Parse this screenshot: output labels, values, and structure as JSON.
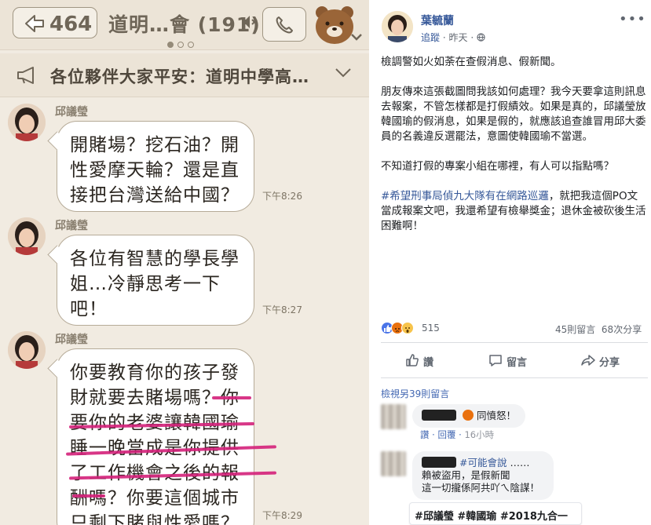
{
  "chat": {
    "back_count": "464",
    "title": "道明…會 (191)",
    "announcement": "各位夥伴大家平安：道明中學高…",
    "messages": [
      {
        "sender": "邱議瑩",
        "lines": [
          "開賭場？挖石油？開",
          "性愛摩天輪？還是直",
          "接把台灣送給中國？"
        ],
        "time": "下午8:26"
      },
      {
        "sender": "邱議瑩",
        "lines": [
          "各位有智慧的學長學",
          "姐…冷靜思考一下",
          "吧！"
        ],
        "time": "下午8:27"
      },
      {
        "sender": "邱議瑩",
        "lines": [
          "你要教育你的孩子發",
          "財就要去賭場嗎？你",
          "要你的老婆讓韓國瑜",
          "睡一晚當成是你提供",
          "了工作機會之後的報",
          "酬嗎？你要這個城市",
          "只剩下賭與性愛嗎？"
        ],
        "time": "下午8:29"
      }
    ],
    "colors": {
      "background": "#f1ebe1",
      "underline": "#d4217a"
    }
  },
  "post": {
    "author": "葉毓蘭",
    "follow_label": "追蹤",
    "time": "昨天",
    "paragraphs": [
      "檢調警如火如荼在查假消息、假新聞。",
      "朋友傳來這張截圖問我該如何處理？我今天要拿這則訊息去報案，不管怎樣都是打假績效。如果是真的，邱議瑩放韓國瑜的假消息，如果是假的，就應該追查誰冒用邱大委員的名義違反選罷法，意圖使韓國瑜不當選。",
      "不知道打假的專案小組在哪裡，有人可以指點嗎？"
    ],
    "tag_text": "#希望刑事局偵九大隊有在網路巡邏",
    "tag_followup": "，就把我這個PO文當成報案文吧，我還希望有檢舉獎金；退休金被砍後生活困難啊！",
    "reaction_count": "515",
    "comments_count": "45則留言",
    "shares_count": "68次分享",
    "actions": {
      "like": "讚",
      "comment": "留言",
      "share": "分享"
    },
    "view_more": "檢視另39則留言",
    "comments": [
      {
        "text": "同憤怒！",
        "like": "讚",
        "reply": "回覆",
        "time": "16小時"
      },
      {
        "tag": "#可能會說",
        "ellipsis": "……",
        "line2": "賴被盜用，是假新聞",
        "line3": "這一切攏係阿共吖ㄟ陰謀！"
      }
    ],
    "hashtags": "#邱議瑩 #韓國瑜 #2018九合一"
  }
}
